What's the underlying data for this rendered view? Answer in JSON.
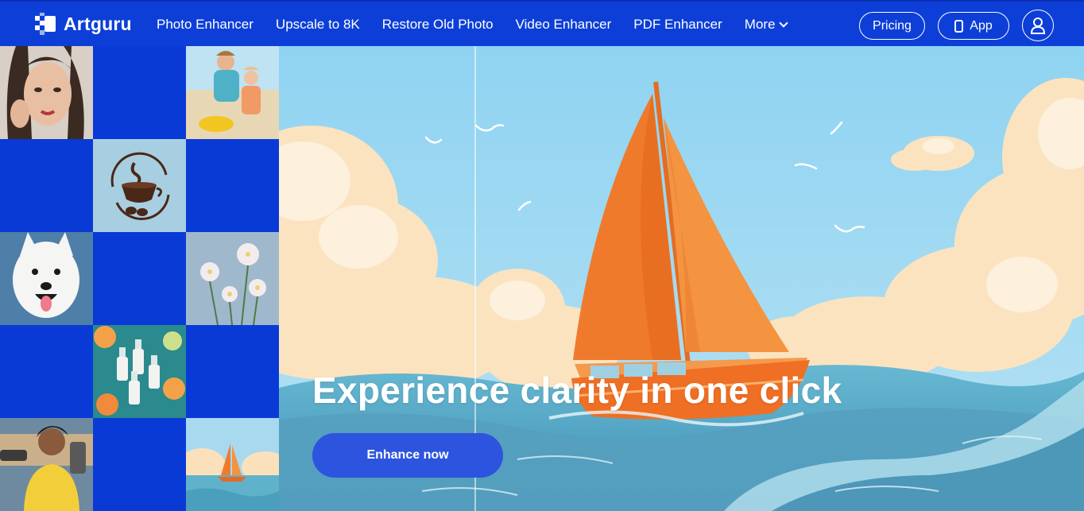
{
  "brand": {
    "name": "Artguru"
  },
  "nav": {
    "links": [
      {
        "label": "Photo Enhancer"
      },
      {
        "label": "Upscale to 8K"
      },
      {
        "label": "Restore Old Photo"
      },
      {
        "label": "Video Enhancer"
      },
      {
        "label": "PDF Enhancer"
      },
      {
        "label": "More"
      }
    ],
    "pricing_label": "Pricing",
    "app_label": "App"
  },
  "hero": {
    "headline": "Experience clarity in one click",
    "cta_label": "Enhance now"
  },
  "icons": {
    "logo": "artguru-logo-icon",
    "more": "chevron-down-icon",
    "app": "phone-icon",
    "account": "user-icon"
  },
  "colors": {
    "brand_blue": "#0d3fd8",
    "cta_blue": "#2d54de",
    "sail_orange": "#f07a2c"
  }
}
